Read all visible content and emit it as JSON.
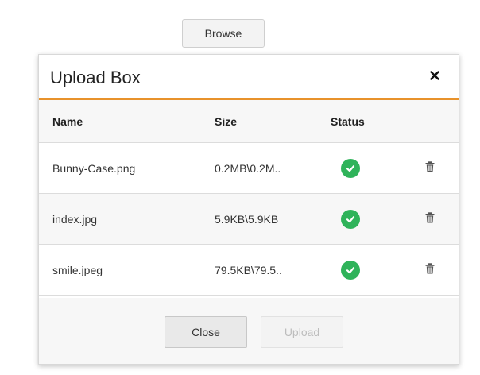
{
  "browse_label": "Browse",
  "dialog": {
    "title": "Upload Box",
    "close_icon": "close-icon",
    "accent_color": "#e8922b"
  },
  "table": {
    "headers": [
      "Name",
      "Size",
      "Status"
    ],
    "files": [
      {
        "name": "Bunny-Case.png",
        "size": "0.2MB\\0.2M..",
        "status_icon": "success-check-icon",
        "delete_icon": "trash-icon"
      },
      {
        "name": "index.jpg",
        "size": "5.9KB\\5.9KB",
        "status_icon": "success-check-icon",
        "delete_icon": "trash-icon"
      },
      {
        "name": "smile.jpeg",
        "size": "79.5KB\\79.5..",
        "status_icon": "success-check-icon",
        "delete_icon": "trash-icon"
      }
    ],
    "success_color": "#2fb35a"
  },
  "footer": {
    "close_label": "Close",
    "upload_label": "Upload"
  }
}
